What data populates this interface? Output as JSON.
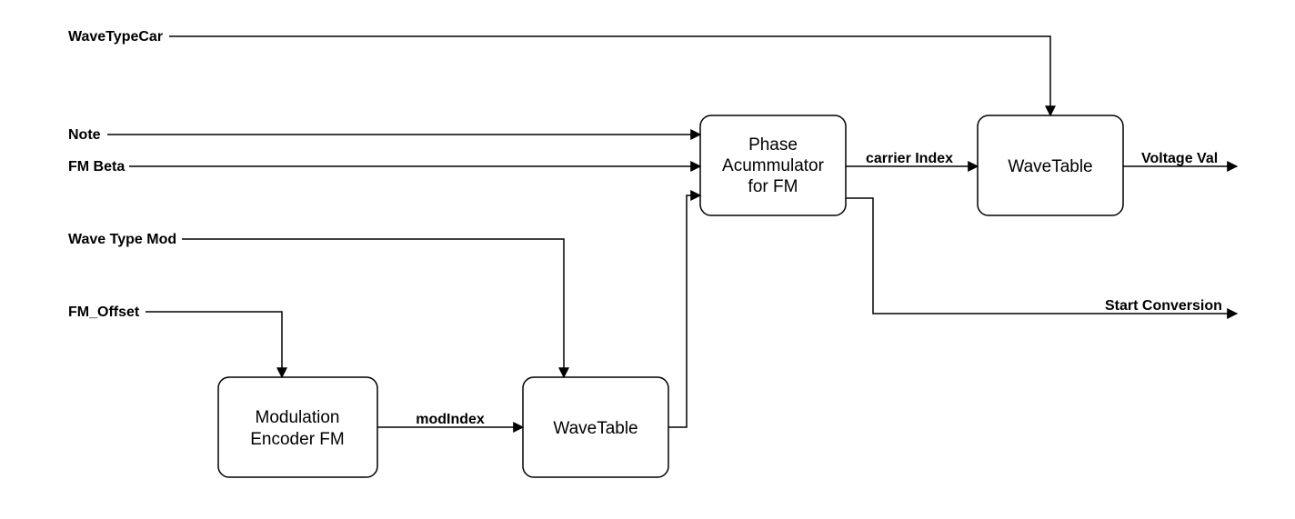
{
  "inputs": {
    "waveTypeCar": "WaveTypeCar",
    "note": "Note",
    "fmBeta": "FM Beta",
    "waveTypeMod": "Wave Type Mod",
    "fmOffset": "FM_Offset"
  },
  "blocks": {
    "modEncoder": {
      "line1": "Modulation",
      "line2": "Encoder FM"
    },
    "waveTable1": "WaveTable",
    "phaseAccum": {
      "line1": "Phase",
      "line2": "Acummulator",
      "line3": "for FM"
    },
    "waveTable2": "WaveTable"
  },
  "edges": {
    "modIndex": "modIndex",
    "carrierIndex": "carrier Index"
  },
  "outputs": {
    "voltageVal": "Voltage Val",
    "startConversion": "Start Conversion"
  }
}
